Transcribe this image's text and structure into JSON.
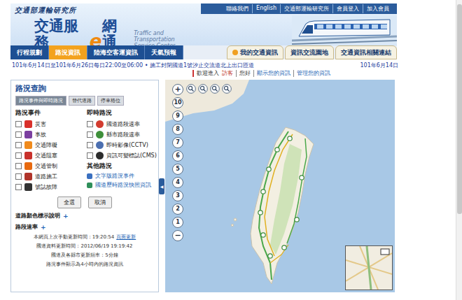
{
  "header": {
    "org": "交通部運輸研究所",
    "title_main": "交通服務",
    "title_e": "e",
    "title_tail": "網通",
    "subtitle": [
      "Traffic and Transportation",
      "Service Center"
    ],
    "links": [
      "聯絡我們",
      "English",
      "交通部運輸研究所",
      "會員登入",
      "加入會員"
    ]
  },
  "nav": {
    "tabs": [
      {
        "label": "行程規劃",
        "selected": false
      },
      {
        "label": "路況資訊",
        "selected": true
      },
      {
        "label": "陸海空客運資訊",
        "selected": false
      },
      {
        "label": "天氣預報",
        "selected": false
      }
    ],
    "right_tabs": [
      "我的交通資訊",
      "資訊交流園地",
      "交通資訊相關連結"
    ]
  },
  "notice": {
    "marquee": "101年6月14日至101年6月26日每日22:00至06:00 • 施工封閉國道1號汐止交流道北上出口匝道",
    "date": "101年6月14日",
    "welcome": [
      "歡迎進入",
      "訪客",
      "您好",
      "顯示您的資訊",
      "管理您的資訊"
    ]
  },
  "sidebar": {
    "title": "路況查詢",
    "modes": [
      {
        "label": "路況事件與即時路況",
        "selected": true
      },
      {
        "label": "替代道路",
        "selected": false
      },
      {
        "label": "停車格位",
        "selected": false
      }
    ],
    "events": {
      "title": "路況事件",
      "items": [
        {
          "label": "災害",
          "checked": false
        },
        {
          "label": "事故",
          "checked": false
        },
        {
          "label": "交通障礙",
          "checked": false
        },
        {
          "label": "交通阻塞",
          "checked": false
        },
        {
          "label": "交通管制",
          "checked": false
        },
        {
          "label": "道路施工",
          "checked": false
        },
        {
          "label": "號誌故障",
          "checked": false
        }
      ]
    },
    "live": {
      "title": "即時路況",
      "items": [
        {
          "label": "國道路段速率",
          "checked": false
        },
        {
          "label": "縣市路段速率",
          "checked": false
        },
        {
          "label": "即時影像(CCTV)",
          "checked": false
        },
        {
          "label": "資訊可變標誌(CMS)",
          "checked": false
        }
      ]
    },
    "other": {
      "title": "其他路況",
      "links": [
        "文字版路況事件",
        "國道歷時路況快照資訊"
      ]
    },
    "buttons": [
      "全選",
      "取消"
    ],
    "legends": [
      {
        "label": "道路顏色標示說明",
        "toggle": "+"
      },
      {
        "label": "路段速率",
        "toggle": "+"
      }
    ],
    "info": [
      {
        "text": "本網頁上次手動更新時間：19:20:54",
        "link": "頁面更新"
      },
      {
        "text": "國道資料更新時間：2012/06/19 19:19:42",
        "link": ""
      },
      {
        "text": "國道及各縣市更新頻率：5分鐘",
        "link": ""
      },
      {
        "text": "路況事件顯示為4小時內的路況資訊",
        "link": ""
      }
    ]
  },
  "map": {
    "collapse": "◀",
    "zoom_in": "+",
    "zoom_out": "−",
    "levels": [
      "10",
      "9",
      "8",
      "7",
      "6",
      "5",
      "4",
      "3",
      "2",
      "1"
    ]
  }
}
